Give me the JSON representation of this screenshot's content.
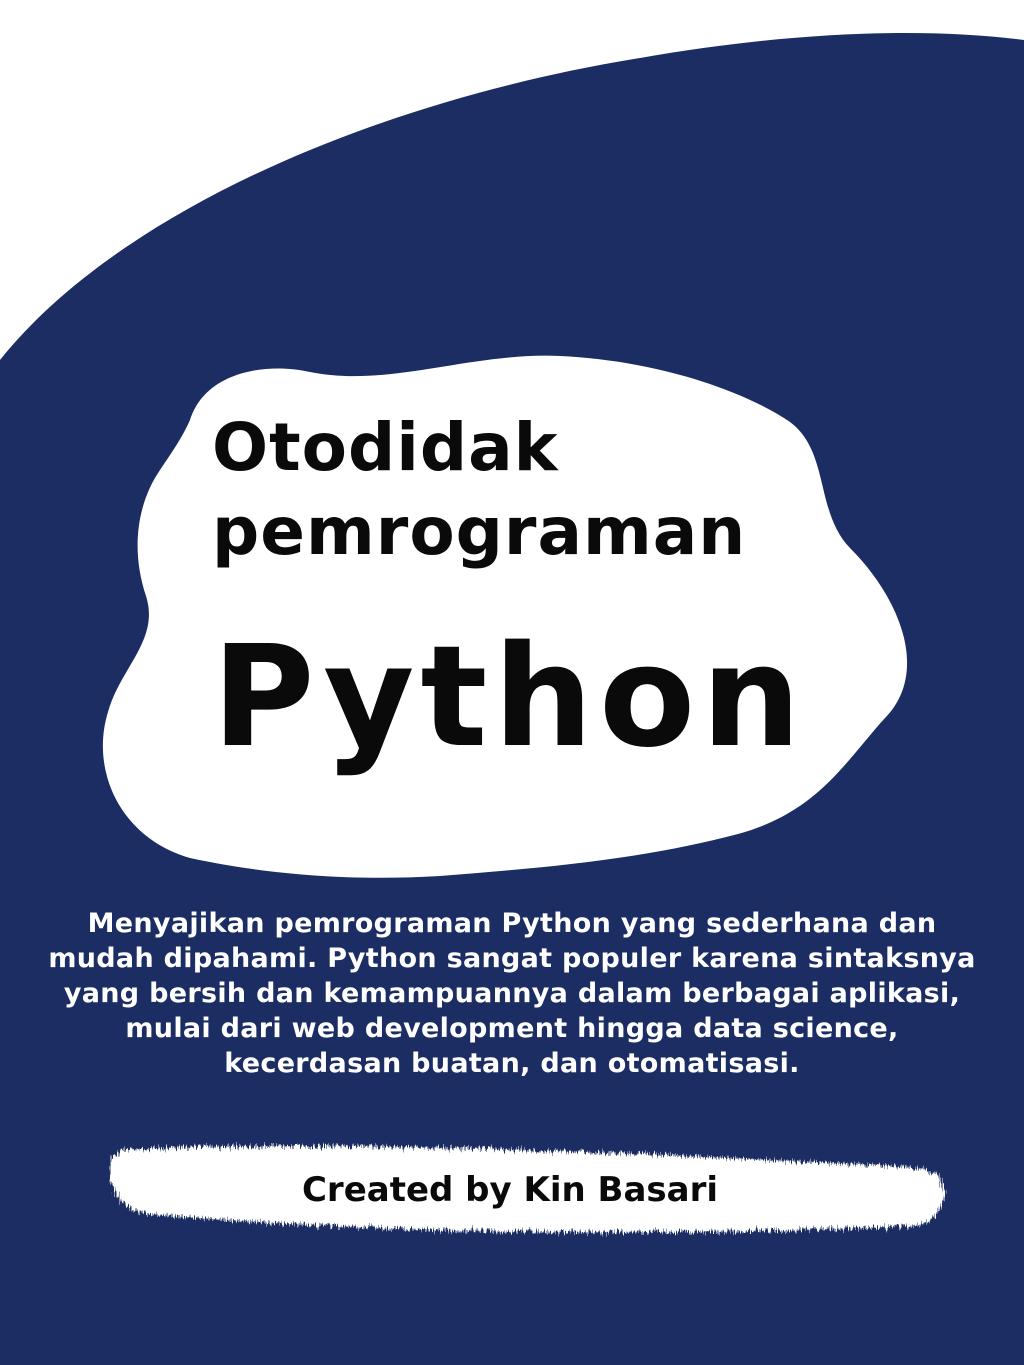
{
  "colors": {
    "background_navy": "#1b2d63",
    "highlight_white": "#ffffff",
    "title_text": "#0a0a0a",
    "body_text": "#ffffff"
  },
  "cover": {
    "title_line1": "Otodidak",
    "title_line2": "pemrograman",
    "title_main": "Python",
    "description": "Menyajikan pemrograman Python yang sederhana dan mudah dipahami. Python sangat populer karena sintaksnya yang bersih dan kemampuannya dalam berbagai aplikasi, mulai dari web development hingga data science, kecerdasan buatan, dan otomatisasi.",
    "credit": "Created by Kin Basari"
  }
}
